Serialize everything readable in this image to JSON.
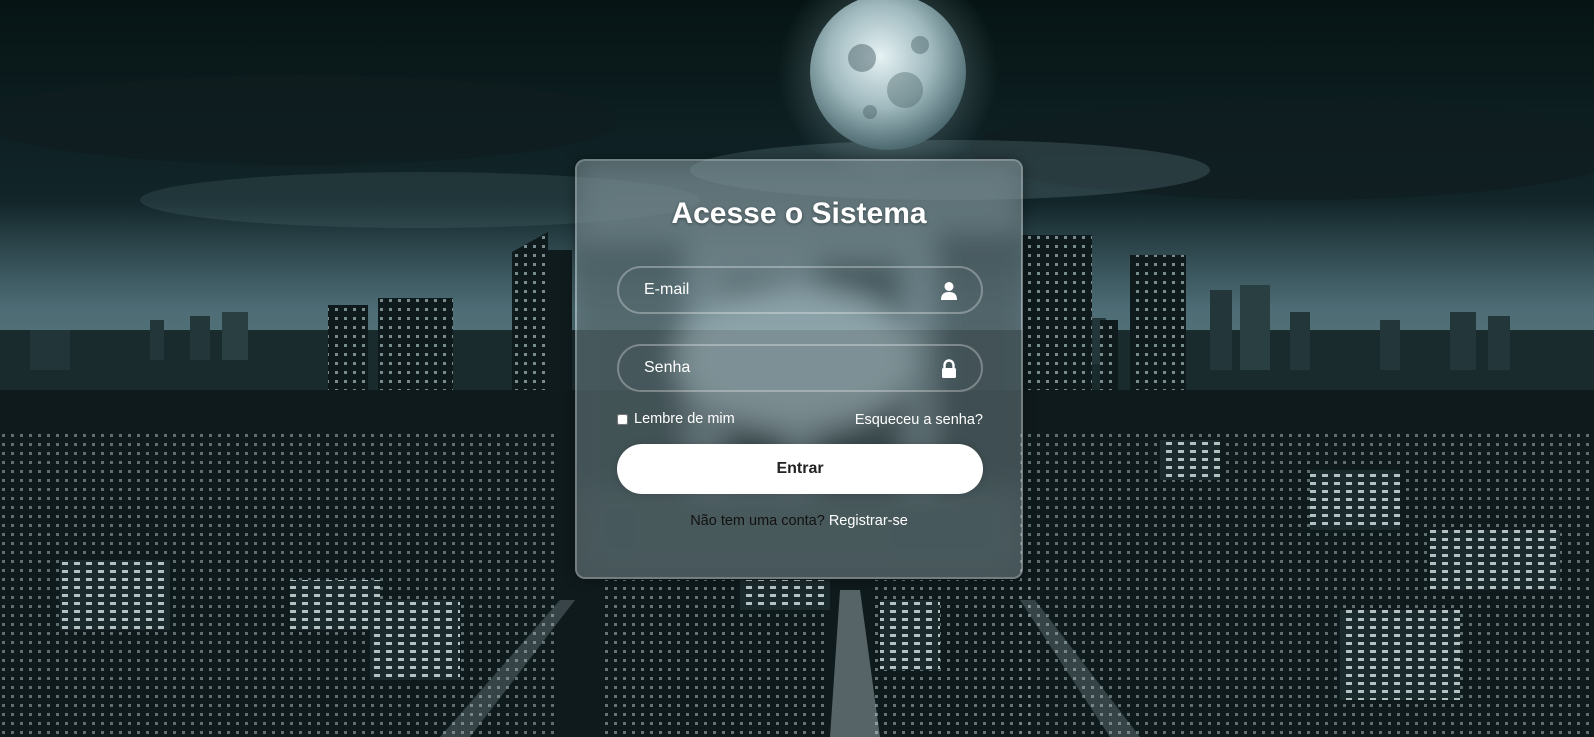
{
  "form": {
    "title": "Acesse o Sistema",
    "email_placeholder": "E-mail",
    "password_placeholder": "Senha",
    "remember_label": "Lembre de mim",
    "forgot_link": "Esqueceu a senha?",
    "submit_label": "Entrar",
    "register_prompt": "Não tem uma conta?",
    "register_link": "Registrar-se"
  },
  "icons": {
    "email": "user-icon",
    "password": "lock-icon"
  },
  "colors": {
    "button_bg": "#ffffff",
    "button_text": "#222222",
    "text": "#ffffff"
  }
}
